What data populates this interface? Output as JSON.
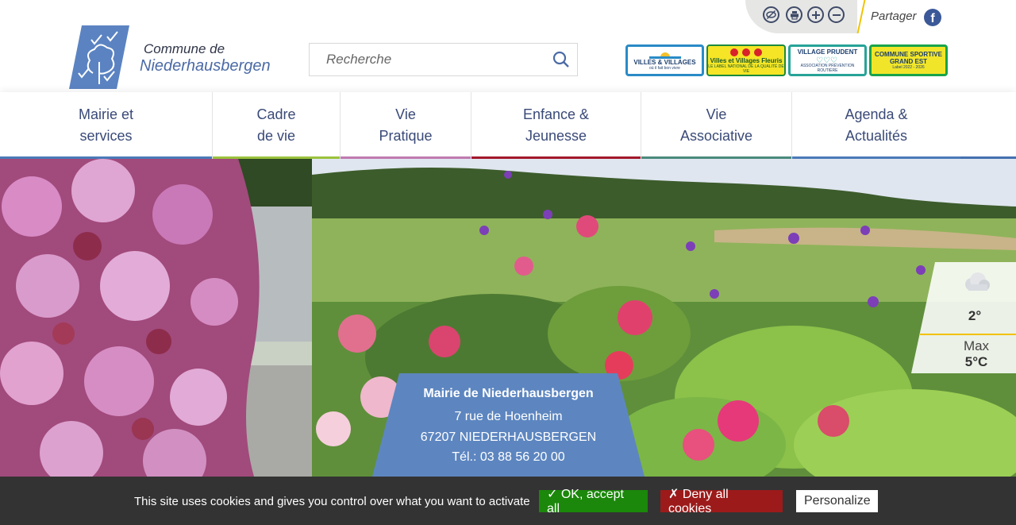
{
  "header": {
    "brand_line1": "Commune de",
    "brand_line2": "Niederhausbergen",
    "search_placeholder": "Recherche",
    "share_label": "Partager",
    "tools": [
      {
        "icon": "contrast-icon"
      },
      {
        "icon": "print-icon"
      },
      {
        "icon": "zoom-in-icon"
      },
      {
        "icon": "zoom-out-icon"
      }
    ],
    "labels": {
      "villes_l1": "VILLES & VILLAGES",
      "villes_l2": "où il fait bon vivre",
      "fleuris_l1": "Villes et Villages Fleuris",
      "fleuris_l2": "LE LABEL NATIONAL DE LA QUALITÉ DE VIE",
      "prudent_l1": "VILLAGE PRUDENT",
      "prudent_l2": "ASSOCIATION PRÉVENTION ROUTIÈRE",
      "sport_l1": "COMMUNE SPORTIVE",
      "sport_l2": "GRAND EST",
      "sport_l3": "Label 2022 - 2026"
    }
  },
  "nav": {
    "items": [
      {
        "label": "Mairie et\nservices",
        "color": "#4a7ab8"
      },
      {
        "label": "Cadre\nde vie",
        "color": "#9bc23c"
      },
      {
        "label": "Vie\nPratique",
        "color": "#c07ab0"
      },
      {
        "label": "Enfance &\nJeunesse",
        "color": "#a3182b"
      },
      {
        "label": "Vie\nAssociative",
        "color": "#4b8a7c"
      },
      {
        "label": "Agenda &\nActualités",
        "color": "#4a7ab8"
      }
    ]
  },
  "weather": {
    "temp": "2°",
    "max_label": "Max",
    "max_value": "5°C",
    "icon": "cloud-icon"
  },
  "mairie": {
    "name": "Mairie de Niederhausbergen",
    "street": "7 rue de Hoenheim",
    "city": "67207 NIEDERHAUSBERGEN",
    "phone": "Tél.: 03 88 56 20 00"
  },
  "cookie": {
    "message": "This site uses cookies and gives you control over what you want to activate",
    "accept": "✓ OK, accept all",
    "deny": "✗ Deny all cookies",
    "personalize": "Personalize"
  },
  "colors": {
    "brand_blue": "#4b6aa6",
    "nav_text": "#3a4a78",
    "mairie_box": "#5d86c0",
    "accent_yellow": "#f2c200"
  }
}
